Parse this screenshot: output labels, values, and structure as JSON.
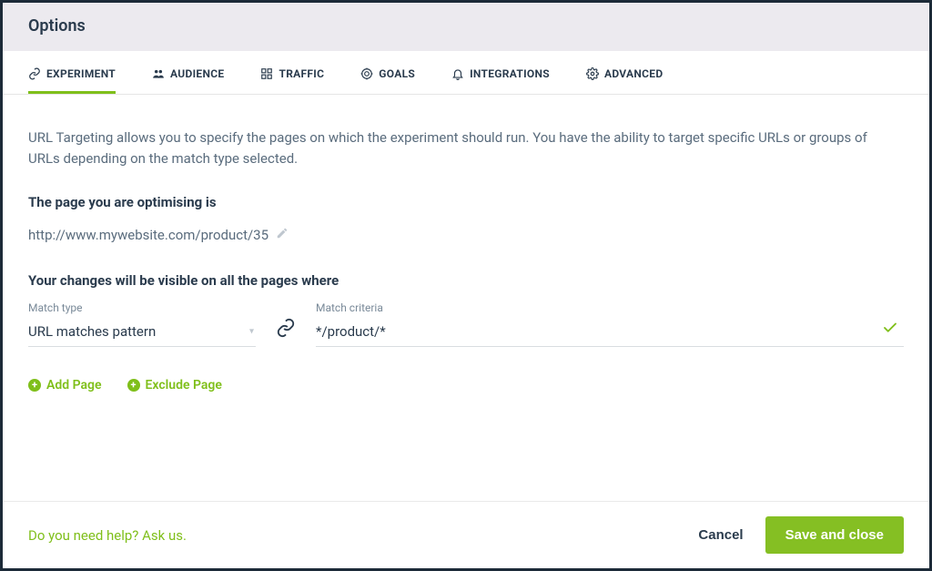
{
  "header": {
    "title": "Options"
  },
  "tabs": [
    {
      "label": "EXPERIMENT",
      "icon": "link"
    },
    {
      "label": "AUDIENCE",
      "icon": "audience"
    },
    {
      "label": "TRAFFIC",
      "icon": "traffic"
    },
    {
      "label": "GOALS",
      "icon": "goals"
    },
    {
      "label": "INTEGRATIONS",
      "icon": "bell"
    },
    {
      "label": "ADVANCED",
      "icon": "gear"
    }
  ],
  "intro": "URL Targeting allows you to specify the pages on which the experiment should run. You have the ability to target specific URLs or groups of URLs depending on the match type selected.",
  "optimising_label": "The page you are optimising is",
  "optimising_url": "http://www.mywebsite.com/product/35",
  "visibility_label": "Your changes will be visible on all the pages where",
  "match_type": {
    "label": "Match type",
    "value": "URL matches pattern"
  },
  "match_criteria": {
    "label": "Match criteria",
    "value": "*/product/*"
  },
  "inline_actions": {
    "add": "Add Page",
    "exclude": "Exclude Page"
  },
  "footer": {
    "help": "Do you need help? Ask us.",
    "cancel": "Cancel",
    "save": "Save and close"
  }
}
